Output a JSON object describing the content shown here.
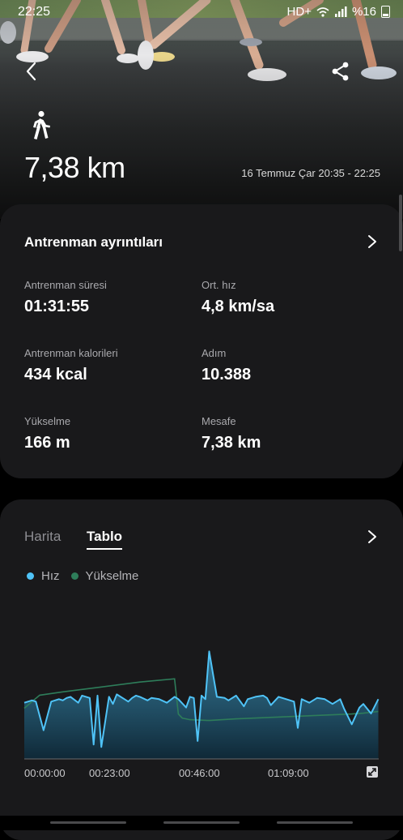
{
  "status": {
    "time": "22:25",
    "network": "HD+",
    "battery": "%16"
  },
  "hero": {
    "distance": "7,38 km",
    "date_range": "16 Temmuz Çar 20:35 - 22:25",
    "activity_icon": "walking-person-icon"
  },
  "details": {
    "title": "Antrenman ayrıntıları",
    "stats": [
      {
        "label": "Antrenman süresi",
        "value": "01:31:55"
      },
      {
        "label": "Ort. hız",
        "value": "4,8 km/sa"
      },
      {
        "label": "Antrenman kalorileri",
        "value": "434 kcal"
      },
      {
        "label": "Adım",
        "value": "10.388"
      },
      {
        "label": "Yükselme",
        "value": "166 m"
      },
      {
        "label": "Mesafe",
        "value": "7,38 km"
      }
    ]
  },
  "chart_section": {
    "tabs": [
      "Harita",
      "Tablo"
    ],
    "selected_tab": "Tablo"
  },
  "chart_data": {
    "type": "area",
    "x_ticks": [
      "00:00:00",
      "00:23:00",
      "00:46:00",
      "01:09:00"
    ],
    "legend": [
      {
        "name": "Hız",
        "color": "#4fc3f7"
      },
      {
        "name": "Yükselme",
        "color": "#2e7d5a"
      }
    ],
    "series": [
      {
        "name": "Hız",
        "color": "#4fc3f7",
        "x_minutes": [
          0,
          2,
          3,
          5,
          7,
          9,
          10,
          11,
          12,
          14,
          15,
          17,
          18,
          19,
          20,
          22,
          23,
          24,
          26,
          27,
          28,
          29,
          30,
          32,
          33,
          35,
          37,
          39,
          40,
          42,
          43,
          44,
          45,
          46,
          47,
          48,
          50,
          52,
          53,
          55,
          57,
          58,
          60,
          62,
          63,
          64,
          66,
          68,
          70,
          71,
          72,
          74,
          76,
          78,
          80,
          82,
          83,
          85,
          87,
          88,
          90,
          91.9
        ],
        "values": [
          4.7,
          4.9,
          4.8,
          2.4,
          4.8,
          5.0,
          4.9,
          5.1,
          5.2,
          4.7,
          5.3,
          5.1,
          1.2,
          5.3,
          1.0,
          5.2,
          4.6,
          5.4,
          5.0,
          4.8,
          5.1,
          5.3,
          5.2,
          4.9,
          5.1,
          5.0,
          4.7,
          5.2,
          5.0,
          4.3,
          5.2,
          5.1,
          1.5,
          5.3,
          5.0,
          9.0,
          5.2,
          5.1,
          4.9,
          5.3,
          4.4,
          5.0,
          5.2,
          5.3,
          5.1,
          4.5,
          5.2,
          5.0,
          4.8,
          2.6,
          5.0,
          4.7,
          5.1,
          5.0,
          4.6,
          5.0,
          4.2,
          2.9,
          4.3,
          4.6,
          3.8,
          5.0
        ]
      },
      {
        "name": "Yükselme",
        "color": "#2e7d5a",
        "x_minutes": [
          0,
          2,
          4,
          10,
          20,
          30,
          39,
          40,
          41,
          43,
          48,
          55,
          60,
          70,
          80,
          85,
          88,
          90,
          91.9
        ],
        "values": [
          0.62,
          0.7,
          0.78,
          0.82,
          0.88,
          0.94,
          0.98,
          0.55,
          0.5,
          0.48,
          0.47,
          0.49,
          0.5,
          0.52,
          0.54,
          0.55,
          0.56,
          0.57,
          0.58
        ]
      }
    ],
    "x_range_minutes": [
      0,
      92
    ]
  }
}
